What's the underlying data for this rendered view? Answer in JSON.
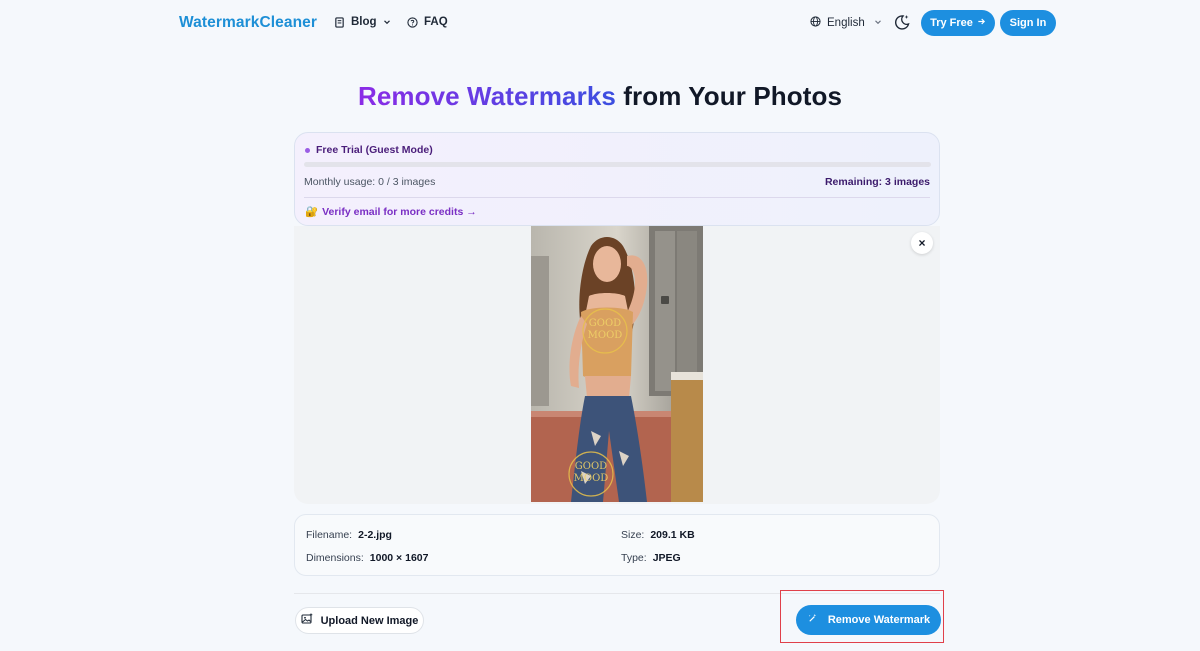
{
  "nav": {
    "logo": "WatermarkCleaner",
    "blog": "Blog",
    "faq": "FAQ",
    "language": "English",
    "try_free": "Try Free",
    "sign_in": "Sign In",
    "icons": [
      "book-icon",
      "chevron-down-icon",
      "help-circle-icon",
      "globe-icon",
      "moon-sparkle-icon",
      "arrow-right-icon"
    ]
  },
  "hero": {
    "highlight": "Remove Watermarks",
    "rest": "from Your Photos"
  },
  "trial": {
    "title": "Free Trial (Guest Mode)",
    "usage_label": "Monthly usage: 0 / 3 images",
    "usage_fraction": 0,
    "remaining": "Remaining: 3 images",
    "verify_emoji": "🔐",
    "verify_text": "Verify email for more credits →"
  },
  "preview": {
    "close": "×",
    "watermark_text": [
      "GOOD",
      "MOOD"
    ]
  },
  "file_info": {
    "filename_label": "Filename:",
    "filename": "2-2.jpg",
    "dimensions_label": "Dimensions:",
    "dimensions": "1000 × 1607",
    "size_label": "Size:",
    "size": "209.1 KB",
    "type_label": "Type:",
    "type": "JPEG"
  },
  "actions": {
    "upload": "Upload New Image",
    "remove": "Remove Watermark"
  },
  "colors": {
    "accent": "#1d8fe0",
    "logo": "#1d8fd6",
    "purple": "#7a2fc4",
    "highlight_box": "#e0404a"
  }
}
